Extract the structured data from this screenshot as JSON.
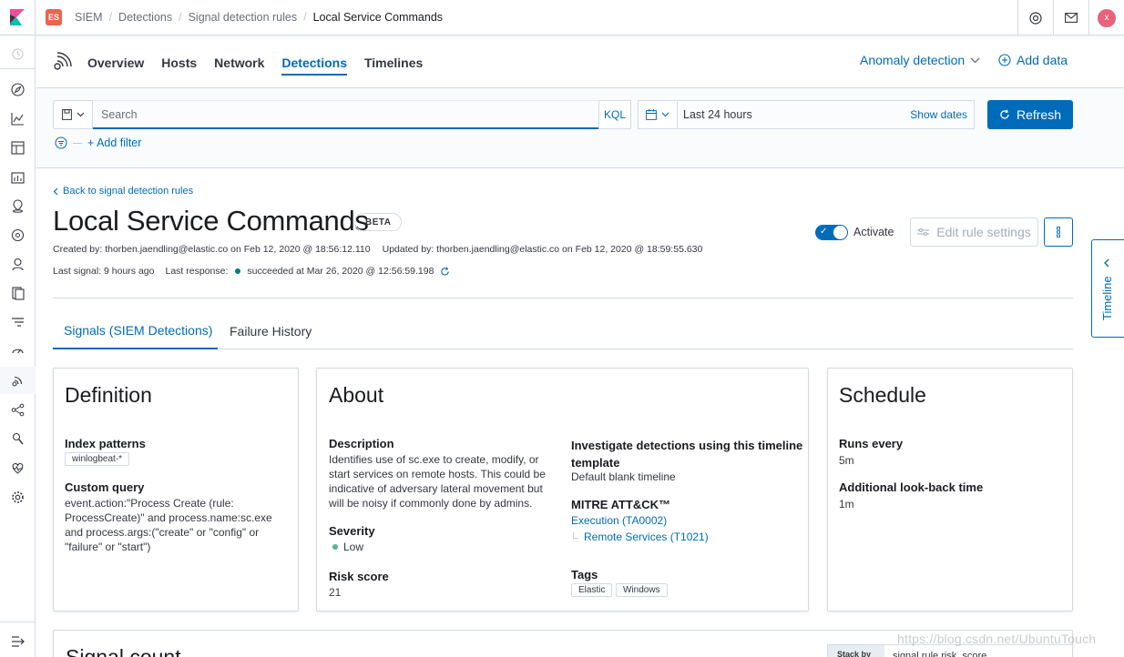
{
  "header": {
    "space_avatar": "ES",
    "breadcrumbs": [
      "SIEM",
      "Detections",
      "Signal detection rules",
      "Local Service Commands"
    ],
    "user_avatar": "x"
  },
  "app_nav": {
    "tabs": [
      "Overview",
      "Hosts",
      "Network",
      "Detections",
      "Timelines"
    ],
    "active_tab": "Detections",
    "anomaly_label": "Anomaly detection",
    "add_data_label": "Add data"
  },
  "search": {
    "placeholder": "Search",
    "query_language": "KQL",
    "time_range": "Last 24 hours",
    "show_dates": "Show dates",
    "refresh_label": "Refresh",
    "add_filter": "+ Add filter"
  },
  "rule": {
    "back_link": "Back to signal detection rules",
    "title": "Local Service Commands",
    "badge": "BETA",
    "created_by": "Created by: thorben.jaendling@elastic.co on Feb 12, 2020 @ 18:56:12.110",
    "updated_by": "Updated by: thorben.jaendling@elastic.co on Feb 12, 2020 @ 18:59:55.630",
    "last_signal": "Last signal: 9 hours ago",
    "last_response_label": "Last response:",
    "last_response_value": "succeeded at Mar 26, 2020 @ 12:56:59.198",
    "activate_label": "Activate",
    "edit_label": "Edit rule settings"
  },
  "subtabs": [
    "Signals (SIEM Detections)",
    "Failure History"
  ],
  "definition": {
    "title": "Definition",
    "index_patterns_label": "Index patterns",
    "index_patterns": [
      "winlogbeat-*"
    ],
    "custom_query_label": "Custom query",
    "custom_query_lines": [
      "event.action:\"Process Create (rule:",
      "ProcessCreate)\" and process.name:sc.exe",
      "and process.args:(\"create\" or \"config\" or",
      "\"failure\" or \"start\")"
    ]
  },
  "about": {
    "title": "About",
    "description_label": "Description",
    "description_lines": [
      "Identifies use of sc.exe to create, modify, or",
      "start services on remote hosts. This could be",
      "indicative of adversary lateral movement but",
      "will be noisy if commonly done by admins."
    ],
    "severity_label": "Severity",
    "severity_value": "Low",
    "risk_label": "Risk score",
    "risk_value": "21",
    "timeline_label_lines": [
      "Investigate detections using this timeline",
      "template"
    ],
    "timeline_value": "Default blank timeline",
    "mitre_label": "MITRE ATT&CK™",
    "mitre_tactic": "Execution (TA0002)",
    "mitre_technique": "Remote Services (T1021)",
    "tags_label": "Tags",
    "tags": [
      "Elastic",
      "Windows"
    ]
  },
  "schedule": {
    "title": "Schedule",
    "runs_every_label": "Runs every",
    "runs_every_value": "5m",
    "lookback_label": "Additional look-back time",
    "lookback_value": "1m"
  },
  "timeline_flyout": {
    "label": "Timeline"
  },
  "signal_count": {
    "title": "Signal count",
    "stack_by_label": "Stack by",
    "stack_by_value": "signal.rule.risk_score"
  },
  "watermark": "https://blog.csdn.net/UbuntuTouch"
}
